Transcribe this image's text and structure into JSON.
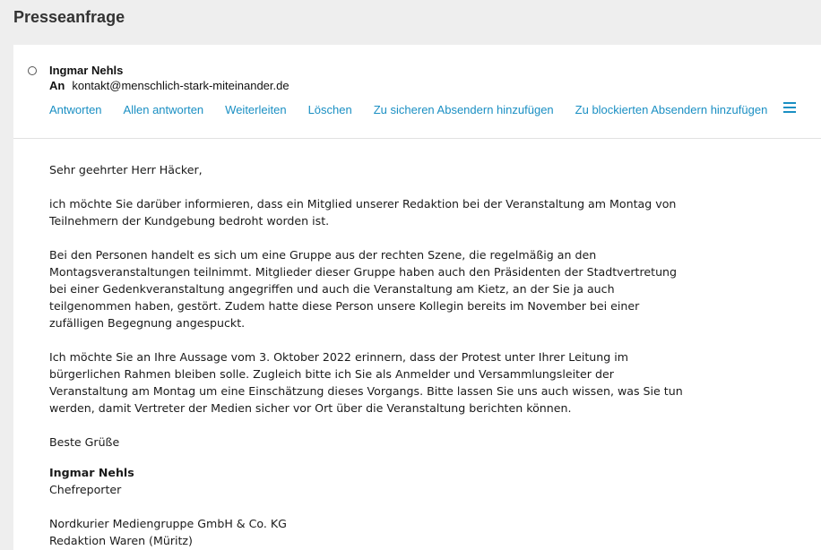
{
  "page": {
    "title": "Presseanfrage"
  },
  "message": {
    "sender": "Ingmar Nehls",
    "to_label": "An",
    "to_address": "kontakt@menschlich-stark-miteinander.de"
  },
  "actions": [
    {
      "label": "Antworten"
    },
    {
      "label": "Allen antworten"
    },
    {
      "label": "Weiterleiten"
    },
    {
      "label": "Löschen"
    },
    {
      "label": "Zu sicheren Absendern hinzufügen"
    },
    {
      "label": "Zu blockierten Absendern hinzufügen"
    }
  ],
  "icons": {
    "menu": "hamburger-icon",
    "select": "radio-icon"
  },
  "colors": {
    "accent": "#1a8fc3",
    "background": "#eeeeee",
    "panel": "#ffffff"
  },
  "body": {
    "greeting": "Sehr geehrter Herr Häcker,",
    "paragraphs": [
      "ich möchte Sie darüber informieren, dass ein Mitglied unserer Redaktion bei der Veranstaltung am Montag von Teilnehmern der Kundgebung bedroht worden ist.",
      "Bei den Personen handelt es sich um eine Gruppe aus der rechten Szene, die regelmäßig an den Montagsveranstaltungen teilnimmt. Mitglieder dieser Gruppe haben auch den Präsidenten der Stadtvertretung bei einer Gedenkveranstaltung angegriffen und auch die Veranstaltung am Kietz, an der Sie ja auch teilgenommen haben, gestört. Zudem hatte diese Person unsere Kollegin bereits im November bei einer zufälligen Begegnung angespuckt.",
      "Ich möchte Sie an Ihre Aussage vom 3. Oktober 2022 erinnern, dass der Protest unter Ihrer Leitung im bürgerlichen Rahmen bleiben solle. Zugleich bitte ich Sie als Anmelder und Versammlungsleiter der Veranstaltung am Montag um eine Einschätzung dieses Vorgangs. Bitte lassen Sie uns auch wissen, was Sie tun werden, damit Vertreter der Medien sicher vor Ort über die Veranstaltung berichten können."
    ],
    "closing": "Beste Grüße",
    "signature_name": "Ingmar Nehls",
    "signature_title": "Chefreporter",
    "company": "Nordkurier Mediengruppe GmbH & Co. KG",
    "department": "Redaktion Waren (Müritz)"
  }
}
